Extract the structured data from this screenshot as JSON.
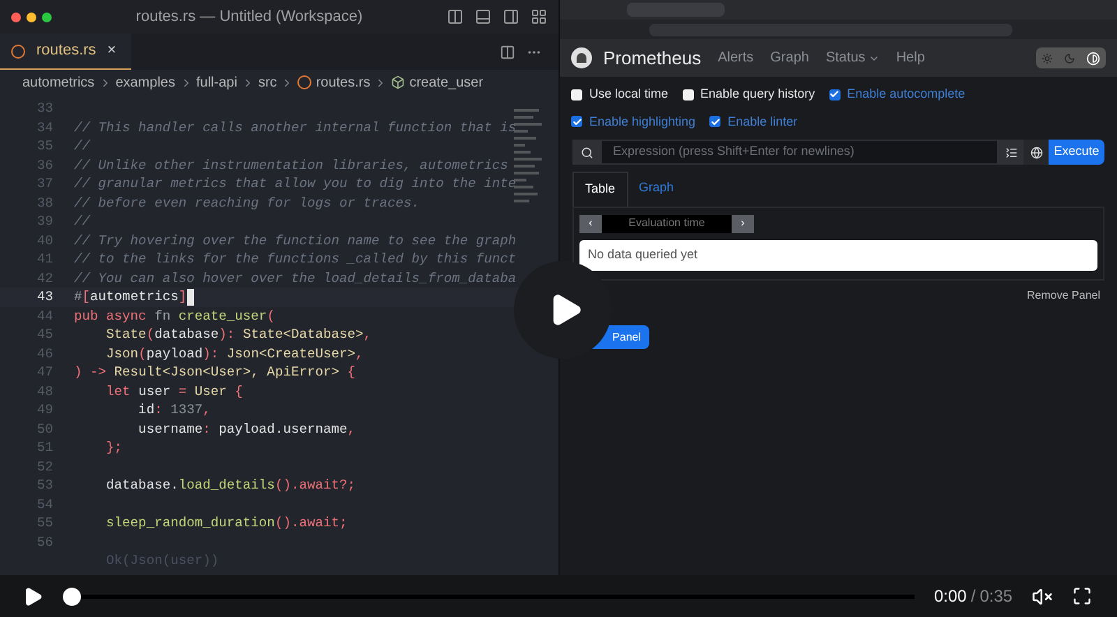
{
  "editor": {
    "window_title": "routes.rs — Untitled (Workspace)",
    "tab": {
      "label": "routes.rs",
      "close": "×"
    },
    "breadcrumb": [
      {
        "kind": "folder",
        "label": "autometrics"
      },
      {
        "kind": "folder",
        "label": "examples"
      },
      {
        "kind": "folder",
        "label": "full-api"
      },
      {
        "kind": "folder",
        "label": "src"
      },
      {
        "kind": "file",
        "label": "routes.rs"
      },
      {
        "kind": "symbol",
        "label": "create_user"
      }
    ],
    "lines": [
      {
        "num": "33",
        "current": false
      },
      {
        "num": "34",
        "current": false,
        "tokens": [
          {
            "kind": "comment",
            "text": "// This handler calls another internal function that is"
          }
        ]
      },
      {
        "num": "35",
        "current": false,
        "tokens": [
          {
            "kind": "comment",
            "text": "//"
          }
        ]
      },
      {
        "num": "36",
        "current": false,
        "tokens": [
          {
            "kind": "comment",
            "text": "// Unlike other instrumentation libraries, autometrics"
          }
        ]
      },
      {
        "num": "37",
        "current": false,
        "tokens": [
          {
            "kind": "comment",
            "text": "// granular metrics that allow you to dig into the inte"
          }
        ]
      },
      {
        "num": "38",
        "current": false,
        "tokens": [
          {
            "kind": "comment",
            "text": "// before even reaching for logs or traces."
          }
        ]
      },
      {
        "num": "39",
        "current": false,
        "tokens": [
          {
            "kind": "comment",
            "text": "//"
          }
        ]
      },
      {
        "num": "40",
        "current": false,
        "tokens": [
          {
            "kind": "comment",
            "text": "// Try hovering over the function name to see the graph"
          }
        ]
      },
      {
        "num": "41",
        "current": false,
        "tokens": [
          {
            "kind": "comment",
            "text": "// to the links for the functions _called by this funct"
          }
        ]
      },
      {
        "num": "42",
        "current": false,
        "tokens": [
          {
            "kind": "comment",
            "text": "// You can also hover over the load_details_from_databa"
          }
        ]
      },
      {
        "num": "43",
        "current": true,
        "tokens": [
          {
            "kind": "muted",
            "text": "#"
          },
          {
            "kind": "punct",
            "text": "["
          },
          {
            "kind": "plain",
            "text": "autometrics"
          },
          {
            "kind": "punct",
            "text": "]"
          }
        ]
      },
      {
        "num": "44",
        "current": false,
        "tokens": [
          {
            "kind": "keyword",
            "text": "pub async "
          },
          {
            "kind": "muted",
            "text": "fn "
          },
          {
            "kind": "function",
            "text": "create_user"
          },
          {
            "kind": "punct",
            "text": "("
          }
        ]
      },
      {
        "num": "45",
        "current": false,
        "tokens": [
          {
            "kind": "type",
            "text": "    State"
          },
          {
            "kind": "punct",
            "text": "("
          },
          {
            "kind": "plain",
            "text": "database"
          },
          {
            "kind": "punct",
            "text": "): "
          },
          {
            "kind": "type",
            "text": "State<Database>"
          },
          {
            "kind": "punct",
            "text": ","
          }
        ]
      },
      {
        "num": "46",
        "current": false,
        "tokens": [
          {
            "kind": "type",
            "text": "    Json"
          },
          {
            "kind": "punct",
            "text": "("
          },
          {
            "kind": "plain",
            "text": "payload"
          },
          {
            "kind": "punct",
            "text": "): "
          },
          {
            "kind": "type",
            "text": "Json<CreateUser>"
          },
          {
            "kind": "punct",
            "text": ","
          }
        ]
      },
      {
        "num": "47",
        "current": false,
        "tokens": [
          {
            "kind": "punct",
            "text": ") -> "
          },
          {
            "kind": "type",
            "text": "Result<Json<User>, ApiError> "
          },
          {
            "kind": "punct",
            "text": "{"
          }
        ]
      },
      {
        "num": "48",
        "current": false,
        "tokens": [
          {
            "kind": "keyword",
            "text": "    let "
          },
          {
            "kind": "plain",
            "text": "user "
          },
          {
            "kind": "punct",
            "text": "= "
          },
          {
            "kind": "type",
            "text": "User "
          },
          {
            "kind": "punct",
            "text": "{"
          }
        ]
      },
      {
        "num": "49",
        "current": false,
        "tokens": [
          {
            "kind": "plain",
            "text": "        id"
          },
          {
            "kind": "punct",
            "text": ": "
          },
          {
            "kind": "number",
            "text": "1337"
          },
          {
            "kind": "punct",
            "text": ","
          }
        ]
      },
      {
        "num": "50",
        "current": false,
        "tokens": [
          {
            "kind": "plain",
            "text": "        username"
          },
          {
            "kind": "punct",
            "text": ": "
          },
          {
            "kind": "plain",
            "text": "payload.username"
          },
          {
            "kind": "punct",
            "text": ","
          }
        ]
      },
      {
        "num": "51",
        "current": false,
        "tokens": [
          {
            "kind": "punct",
            "text": "    };"
          }
        ]
      },
      {
        "num": "52",
        "current": false
      },
      {
        "num": "53",
        "current": false,
        "tokens": [
          {
            "kind": "plain",
            "text": "    database."
          },
          {
            "kind": "function",
            "text": "load_details"
          },
          {
            "kind": "punct",
            "text": "()."
          },
          {
            "kind": "keyword",
            "text": "await?"
          },
          {
            "kind": "punct",
            "text": ";"
          }
        ]
      },
      {
        "num": "54",
        "current": false
      },
      {
        "num": "55",
        "current": false,
        "tokens": [
          {
            "kind": "function",
            "text": "    sleep_random_duration"
          },
          {
            "kind": "punct",
            "text": "()."
          },
          {
            "kind": "keyword",
            "text": "await"
          },
          {
            "kind": "punct",
            "text": ";"
          }
        ]
      },
      {
        "num": "56",
        "current": false
      },
      {
        "current": false,
        "tokens": [
          {
            "kind": "faded",
            "text": "    Ok(Json(user))"
          }
        ]
      }
    ]
  },
  "browser": {
    "brand": "Prometheus",
    "nav": [
      {
        "label": "Alerts",
        "dropdown": false
      },
      {
        "label": "Graph",
        "dropdown": false
      },
      {
        "label": "Status",
        "dropdown": true
      },
      {
        "label": "Help",
        "dropdown": false
      }
    ],
    "options": [
      {
        "label": "Use local time",
        "checked": false
      },
      {
        "label": "Enable query history",
        "checked": false
      },
      {
        "label": "Enable autocomplete",
        "checked": true
      },
      {
        "label": "Enable highlighting",
        "checked": true
      },
      {
        "label": "Enable linter",
        "checked": true
      }
    ],
    "expression": {
      "placeholder": "Expression (press Shift+Enter for newlines)",
      "execute": "Execute"
    },
    "tabs": [
      {
        "label": "Table",
        "selected": true
      },
      {
        "label": "Graph",
        "selected": false
      }
    ],
    "prev": "‹",
    "next": "›",
    "evaluation_time": {
      "placeholder": "Evaluation time"
    },
    "empty": "No data queried yet",
    "remove": "Remove Panel",
    "add": "Panel"
  },
  "player": {
    "current": "0:00",
    "separator": "/",
    "duration": "0:35",
    "progress": {
      "level": 0
    }
  }
}
